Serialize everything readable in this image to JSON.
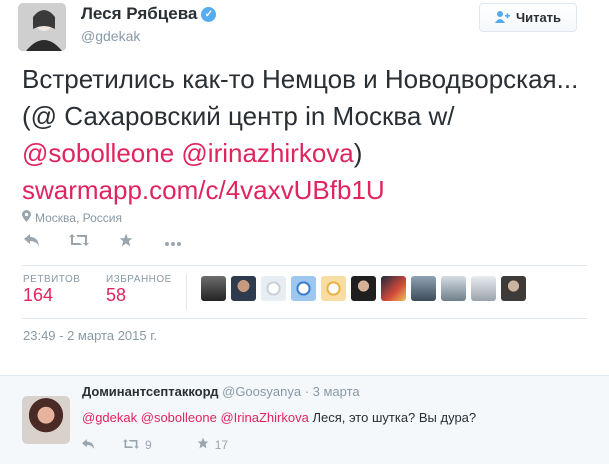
{
  "author": {
    "name": "Леся Рябцева",
    "verified_glyph": "✓",
    "handle": "@gdekak",
    "avatar": "avatar-photo"
  },
  "follow_button": {
    "label": "Читать",
    "icon": "add-user-icon"
  },
  "tweet": {
    "text_plain_1": "Встретились как-то Немцов и Новодворская... (@ Сахаровский центр in Москва w/ ",
    "mention_1": "@sobolleone",
    "space": " ",
    "mention_2": "@irinazhirkova",
    "text_plain_2": ")",
    "url": "swarmapp.com/c/4vaxvUBfb1U"
  },
  "location": {
    "icon": "location-pin-icon",
    "text": "Москва, Россия"
  },
  "actions": {
    "reply_icon": "reply-icon",
    "retweet_icon": "retweet-icon",
    "favorite_icon": "star-icon",
    "more_icon": "more-icon"
  },
  "stats": {
    "retweets_label": "РЕТВИТОВ",
    "retweets_value": "164",
    "favorites_label": "ИЗБРАННОЕ",
    "favorites_value": "58"
  },
  "timestamp": "23:49 - 2 марта 2015 г.",
  "colors": {
    "accent": "#e0245e",
    "blue": "#55acee",
    "muted": "#8899a6",
    "text": "#292f33",
    "divider": "#e1e8ed"
  },
  "reply": {
    "name": "Доминантсептаккорд",
    "handle": "@Goosyanya",
    "sep": " · ",
    "date": "3 марта",
    "mentions": [
      "@gdekak",
      "@sobolleone",
      "@IrinaZhirkova"
    ],
    "text": "Леся, это шутка? Вы дура?",
    "retweets": "9",
    "favorites": "17"
  }
}
